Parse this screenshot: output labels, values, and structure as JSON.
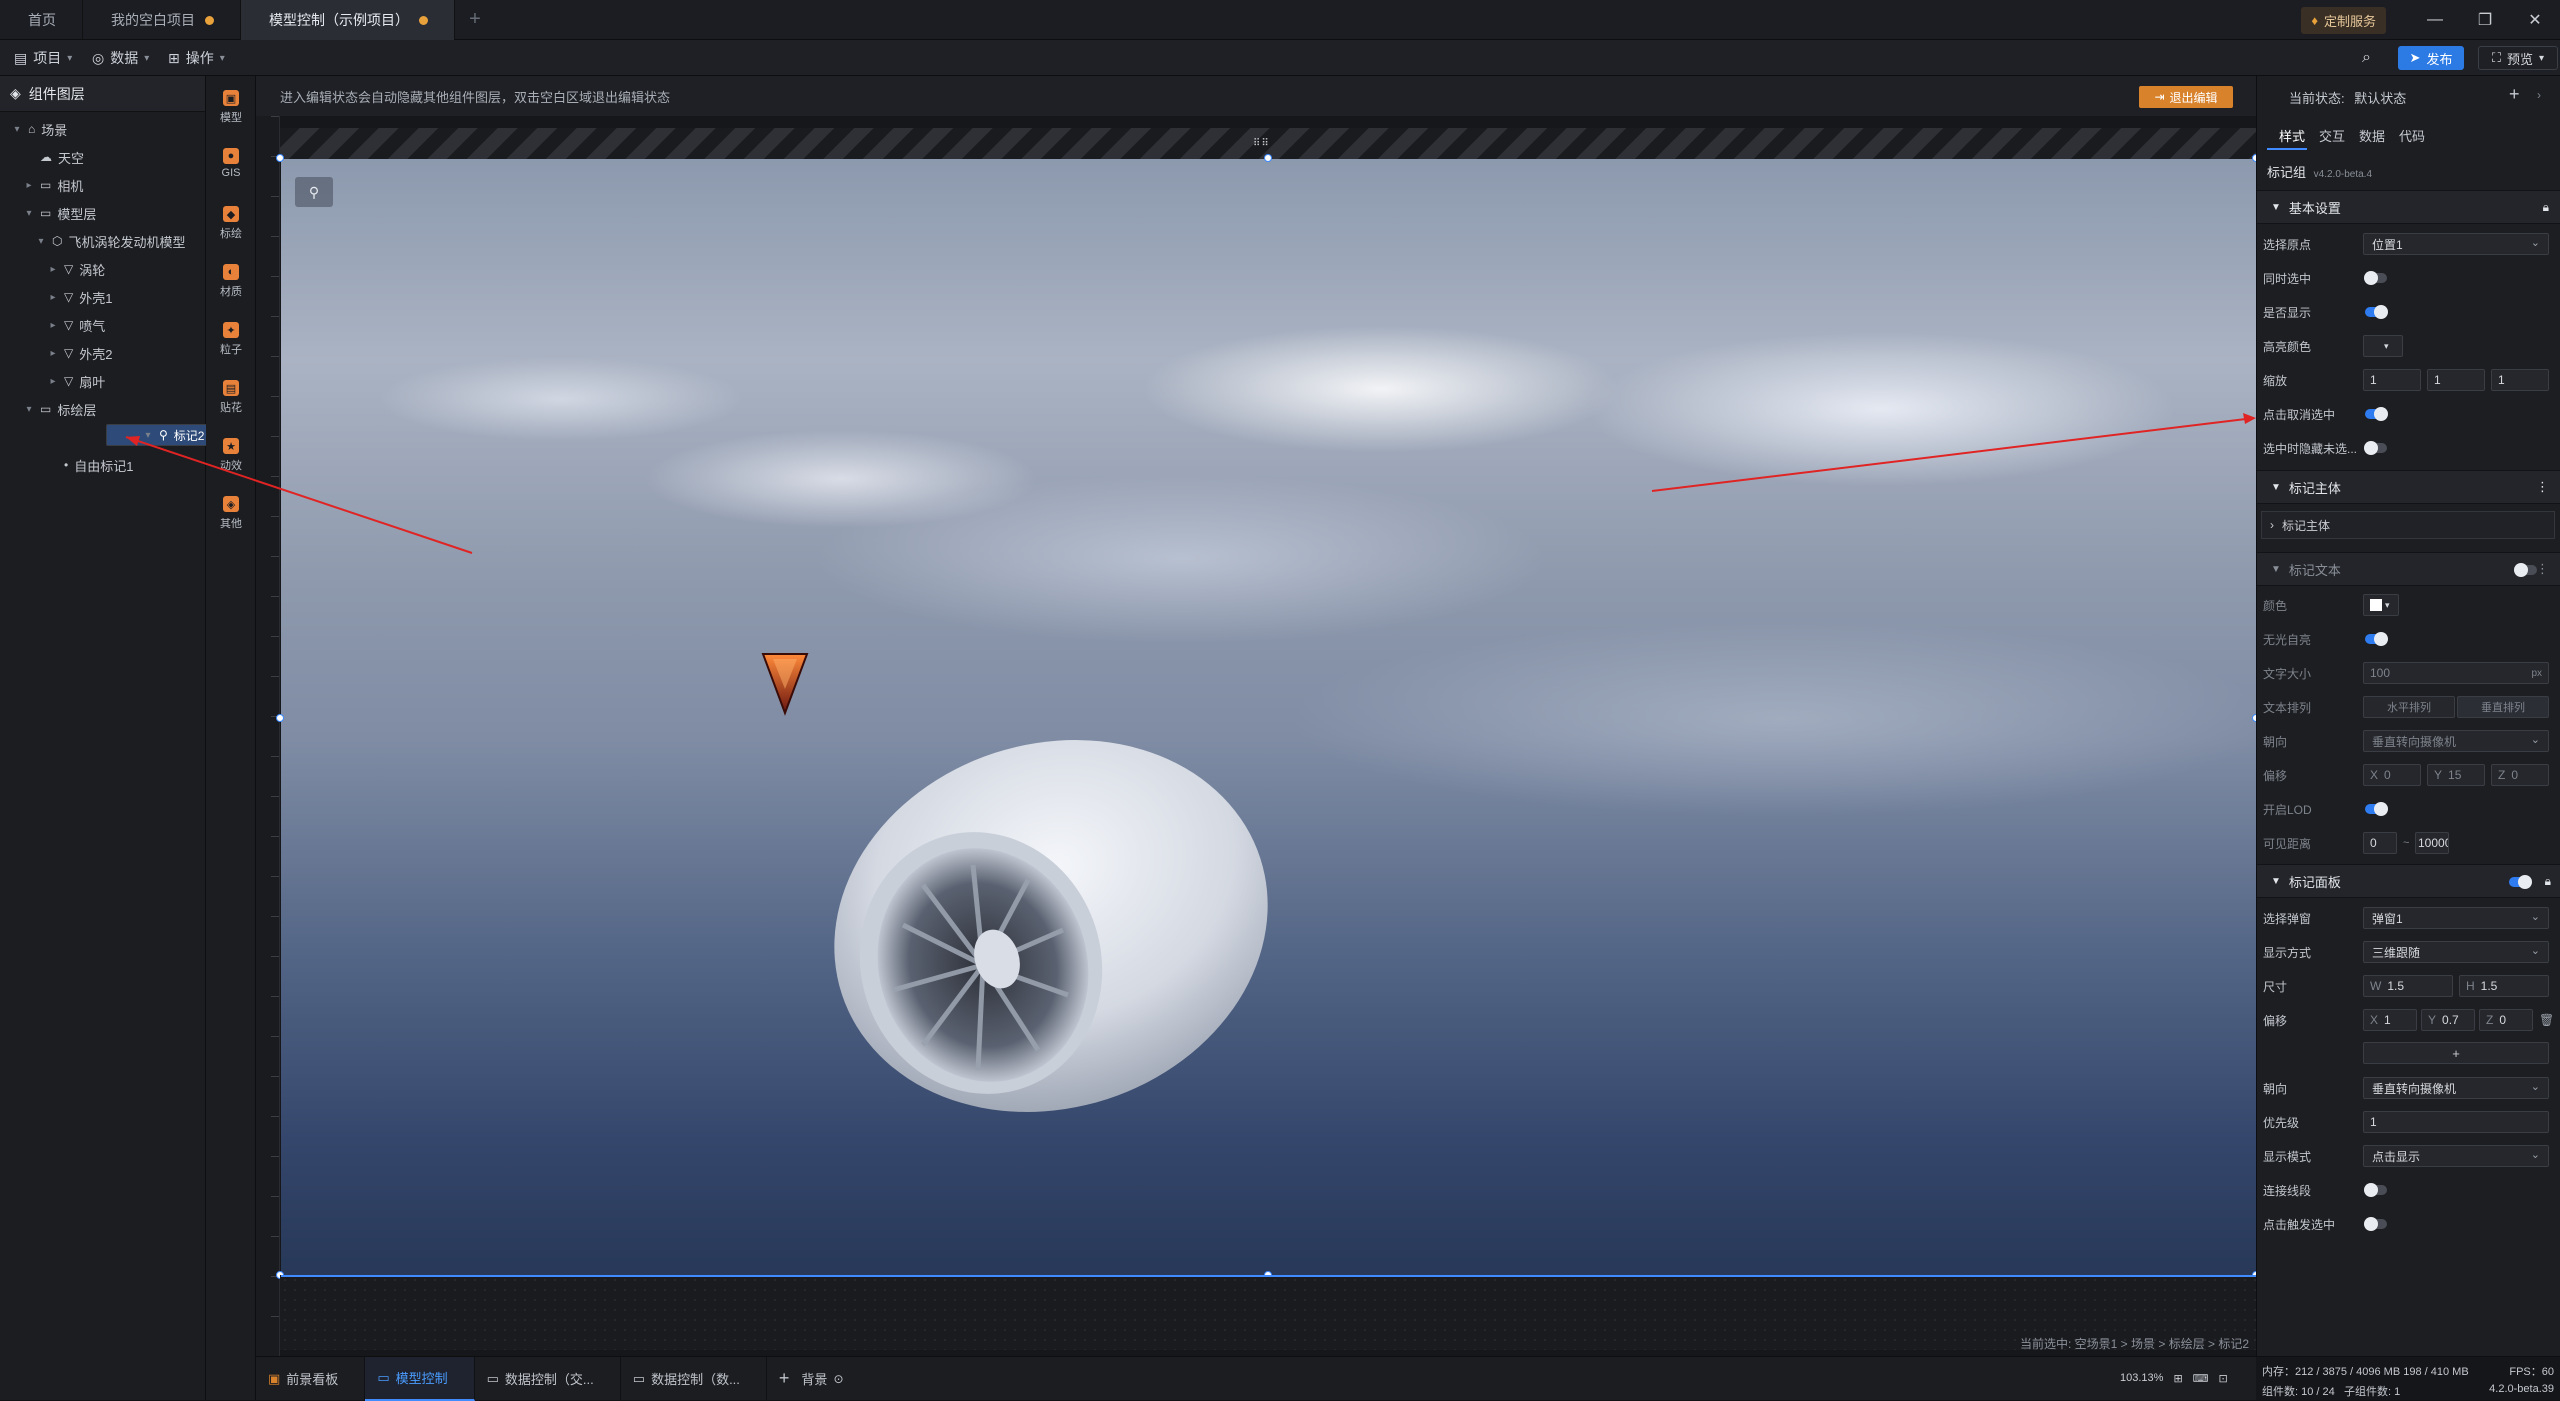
{
  "tabs": [
    {
      "label": "首页",
      "modified": false
    },
    {
      "label": "我的空白项目",
      "modified": true
    },
    {
      "label": "模型控制（示例项目）",
      "modified": true
    }
  ],
  "window": {
    "service_label": "定制服务"
  },
  "toolbar": {
    "menus": [
      "项目",
      "数据",
      "操作"
    ],
    "publish_label": "发布",
    "preview_label": "预览"
  },
  "layers": {
    "title": "组件图层",
    "items": [
      {
        "label": "场景",
        "level": 0,
        "expanded": true,
        "icon": "scene-icon"
      },
      {
        "label": "天空",
        "level": 1,
        "expanded": null,
        "icon": "sky-icon"
      },
      {
        "label": "相机",
        "level": 1,
        "expanded": false,
        "icon": "folder-icon"
      },
      {
        "label": "模型层",
        "level": 1,
        "expanded": true,
        "icon": "folder-icon"
      },
      {
        "label": "飞机涡轮发动机模型",
        "level": 2,
        "expanded": true,
        "icon": "model-icon"
      },
      {
        "label": "涡轮",
        "level": 3,
        "expanded": false,
        "icon": "mesh-icon"
      },
      {
        "label": "外壳1",
        "level": 3,
        "expanded": false,
        "icon": "mesh-icon"
      },
      {
        "label": "喷气",
        "level": 3,
        "expanded": false,
        "icon": "mesh-icon"
      },
      {
        "label": "外壳2",
        "level": 3,
        "expanded": false,
        "icon": "mesh-icon"
      },
      {
        "label": "扇叶",
        "level": 3,
        "expanded": false,
        "icon": "mesh-icon"
      },
      {
        "label": "标绘层",
        "level": 1,
        "expanded": true,
        "icon": "folder-icon"
      },
      {
        "label": "标记2",
        "level": 2,
        "expanded": true,
        "icon": "marker-group-icon",
        "selected": true
      },
      {
        "label": "自由标记1",
        "level": 3,
        "expanded": null,
        "icon": "dot-icon"
      }
    ]
  },
  "palette": [
    {
      "label": "模型",
      "icon": "model-icon",
      "color": "#e8823a"
    },
    {
      "label": "GIS",
      "icon": "globe-icon",
      "color": "#e8823a"
    },
    {
      "label": "标绘",
      "icon": "plot-icon",
      "color": "#e8823a"
    },
    {
      "label": "材质",
      "icon": "material-icon",
      "color": "#e8823a"
    },
    {
      "label": "粒子",
      "icon": "particle-icon",
      "color": "#e8823a"
    },
    {
      "label": "贴花",
      "icon": "decal-icon",
      "color": "#e8823a"
    },
    {
      "label": "动效",
      "icon": "effect-icon",
      "color": "#e8823a"
    },
    {
      "label": "其他",
      "icon": "other-icon",
      "color": "#e8823a"
    }
  ],
  "canvas": {
    "notice": "进入编辑状态会自动隐藏其他组件图层，双击空白区域退出编辑状态",
    "exit_label": "退出编辑",
    "breadcrumb": "当前选中: 空场景1 > 场景 > 标绘层 > 标记2"
  },
  "bottom_tabs": [
    {
      "label": "前景看板",
      "active": false
    },
    {
      "label": "模型控制",
      "active": true
    },
    {
      "label": "数据控制（交...",
      "active": false
    },
    {
      "label": "数据控制（数...",
      "active": false
    }
  ],
  "bottom_bar": {
    "background_label": "背景",
    "zoom": "103.13%"
  },
  "right_panel": {
    "state_label": "当前状态:",
    "state_value": "默认状态",
    "tabs": [
      "样式",
      "交互",
      "数据",
      "代码"
    ],
    "component_name": "标记组",
    "version": "v4.2.0-beta.4",
    "basic": {
      "title": "基本设置",
      "origin_label": "选择原点",
      "origin_value": "位置1",
      "sync_label": "同时选中",
      "show_label": "是否显示",
      "highlight_label": "高亮颜色",
      "scale_label": "缩放",
      "scale": [
        "1",
        "1",
        "1"
      ],
      "click_cancel_label": "点击取消选中",
      "hide_label": "选中时隐藏未选..."
    },
    "marker_body": {
      "title": "标记主体",
      "sub": "标记主体"
    },
    "marker_text": {
      "title": "标记文本",
      "color_label": "颜色",
      "glow_label": "无光自亮",
      "size_label": "文字大小",
      "size_value": "100",
      "size_unit": "px",
      "layout_label": "文本排列",
      "layout_options": [
        "水平排列",
        "垂直排列"
      ],
      "orient_label": "朝向",
      "orient_value": "垂直转向摄像机",
      "offset_label": "偏移",
      "offset_axes": [
        "X",
        "Y",
        "Z"
      ],
      "offset_values": [
        "0",
        "15",
        "0"
      ],
      "lod_label": "开启LOD",
      "range_label": "可见距离",
      "range_min": "0",
      "range_sep": "~",
      "range_max": "10000"
    },
    "marker_panel": {
      "title": "标记面板",
      "popup_label": "选择弹窗",
      "popup_value": "弹窗1",
      "display_label": "显示方式",
      "display_value": "三维跟随",
      "size_label": "尺寸",
      "size_axes": [
        "W",
        "H"
      ],
      "size_values": [
        "1.5",
        "1.5"
      ],
      "offset_label": "偏移",
      "offset_axes": [
        "X",
        "Y",
        "Z"
      ],
      "offset_values": [
        "1",
        "0.7",
        "0"
      ],
      "add_label": "+",
      "orient_label": "朝向",
      "orient_value": "垂直转向摄像机",
      "priority_label": "优先级",
      "priority_value": "1",
      "mode_label": "显示模式",
      "mode_value": "点击显示",
      "line_label": "连接线段",
      "click_label": "点击触发选中"
    }
  },
  "status": {
    "memory": "内存：212 / 3875 / 4096 MB 198 / 410 MB",
    "fps": "FPS：60",
    "components": "组件数: 10 / 24",
    "subcomponents": "子组件数: 1",
    "version": "4.2.0-beta.39"
  },
  "colors": {
    "accent": "#2c7be5",
    "selection": "#2d4a78",
    "exit": "#d8822c",
    "modified_dot": "#e9a23b",
    "annotation_arrow": "#e02424"
  }
}
